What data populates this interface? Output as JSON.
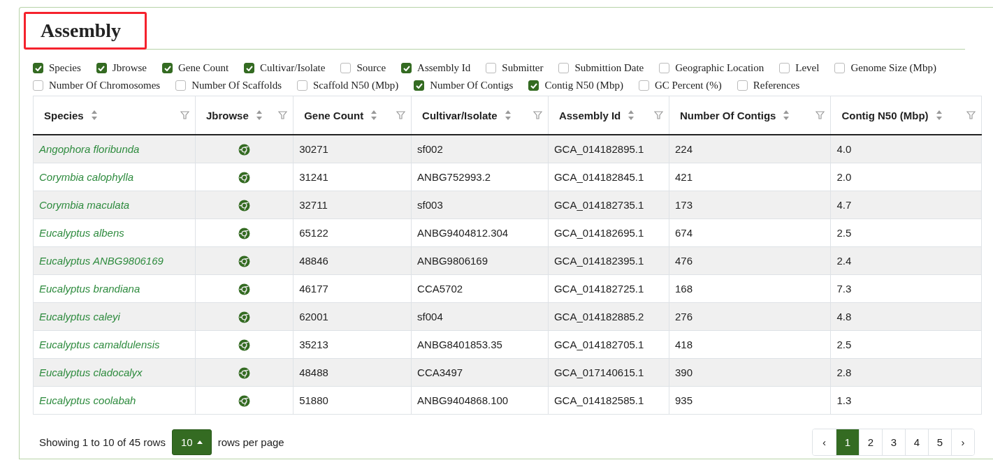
{
  "title": "Assembly",
  "column_toggles": [
    {
      "label": "Species",
      "checked": true
    },
    {
      "label": "Jbrowse",
      "checked": true
    },
    {
      "label": "Gene Count",
      "checked": true
    },
    {
      "label": "Cultivar/Isolate",
      "checked": true
    },
    {
      "label": "Source",
      "checked": false
    },
    {
      "label": "Assembly Id",
      "checked": true
    },
    {
      "label": "Submitter",
      "checked": false
    },
    {
      "label": "Submittion Date",
      "checked": false
    },
    {
      "label": "Geographic Location",
      "checked": false
    },
    {
      "label": "Level",
      "checked": false
    },
    {
      "label": "Genome Size (Mbp)",
      "checked": false
    },
    {
      "label": "Number Of Chromosomes",
      "checked": false
    },
    {
      "label": "Number Of Scaffolds",
      "checked": false
    },
    {
      "label": "Scaffold N50 (Mbp)",
      "checked": false
    },
    {
      "label": "Number Of Contigs",
      "checked": true
    },
    {
      "label": "Contig N50 (Mbp)",
      "checked": true
    },
    {
      "label": "GC Percent (%)",
      "checked": false
    },
    {
      "label": "References",
      "checked": false
    }
  ],
  "table": {
    "columns": [
      {
        "label": "Species",
        "kind": "link"
      },
      {
        "label": "Jbrowse",
        "kind": "icon"
      },
      {
        "label": "Gene Count",
        "kind": "text"
      },
      {
        "label": "Cultivar/Isolate",
        "kind": "text"
      },
      {
        "label": "Assembly Id",
        "kind": "text"
      },
      {
        "label": "Number Of Contigs",
        "kind": "text"
      },
      {
        "label": "Contig N50 (Mbp)",
        "kind": "text"
      }
    ],
    "rows": [
      {
        "cells": [
          "Angophora floribunda",
          "",
          "30271",
          "sf002",
          "GCA_014182895.1",
          "224",
          "4.0"
        ]
      },
      {
        "cells": [
          "Corymbia calophylla",
          "",
          "31241",
          "ANBG752993.2",
          "GCA_014182845.1",
          "421",
          "2.0"
        ]
      },
      {
        "cells": [
          "Corymbia maculata",
          "",
          "32711",
          "sf003",
          "GCA_014182735.1",
          "173",
          "4.7"
        ]
      },
      {
        "cells": [
          "Eucalyptus albens",
          "",
          "65122",
          "ANBG9404812.304",
          "GCA_014182695.1",
          "674",
          "2.5"
        ]
      },
      {
        "cells": [
          "Eucalyptus ANBG9806169",
          "",
          "48846",
          "ANBG9806169",
          "GCA_014182395.1",
          "476",
          "2.4"
        ]
      },
      {
        "cells": [
          "Eucalyptus brandiana",
          "",
          "46177",
          "CCA5702",
          "GCA_014182725.1",
          "168",
          "7.3"
        ]
      },
      {
        "cells": [
          "Eucalyptus caleyi",
          "",
          "62001",
          "sf004",
          "GCA_014182885.2",
          "276",
          "4.8"
        ]
      },
      {
        "cells": [
          "Eucalyptus camaldulensis",
          "",
          "35213",
          "ANBG8401853.35",
          "GCA_014182705.1",
          "418",
          "2.5"
        ]
      },
      {
        "cells": [
          "Eucalyptus cladocalyx",
          "",
          "48488",
          "CCA3497",
          "GCA_017140615.1",
          "390",
          "2.8"
        ]
      },
      {
        "cells": [
          "Eucalyptus coolabah",
          "",
          "51880",
          "ANBG9404868.100",
          "GCA_014182585.1",
          "935",
          "1.3"
        ]
      }
    ]
  },
  "footer": {
    "summary": "Showing 1 to 10 of 45 rows",
    "page_size": "10",
    "page_size_suffix": "rows per page"
  },
  "pagination": [
    {
      "label": "‹",
      "selected": false
    },
    {
      "label": "1",
      "selected": true
    },
    {
      "label": "2",
      "selected": false
    },
    {
      "label": "3",
      "selected": false
    },
    {
      "label": "4",
      "selected": false
    },
    {
      "label": "5",
      "selected": false
    },
    {
      "label": "›",
      "selected": false
    }
  ]
}
